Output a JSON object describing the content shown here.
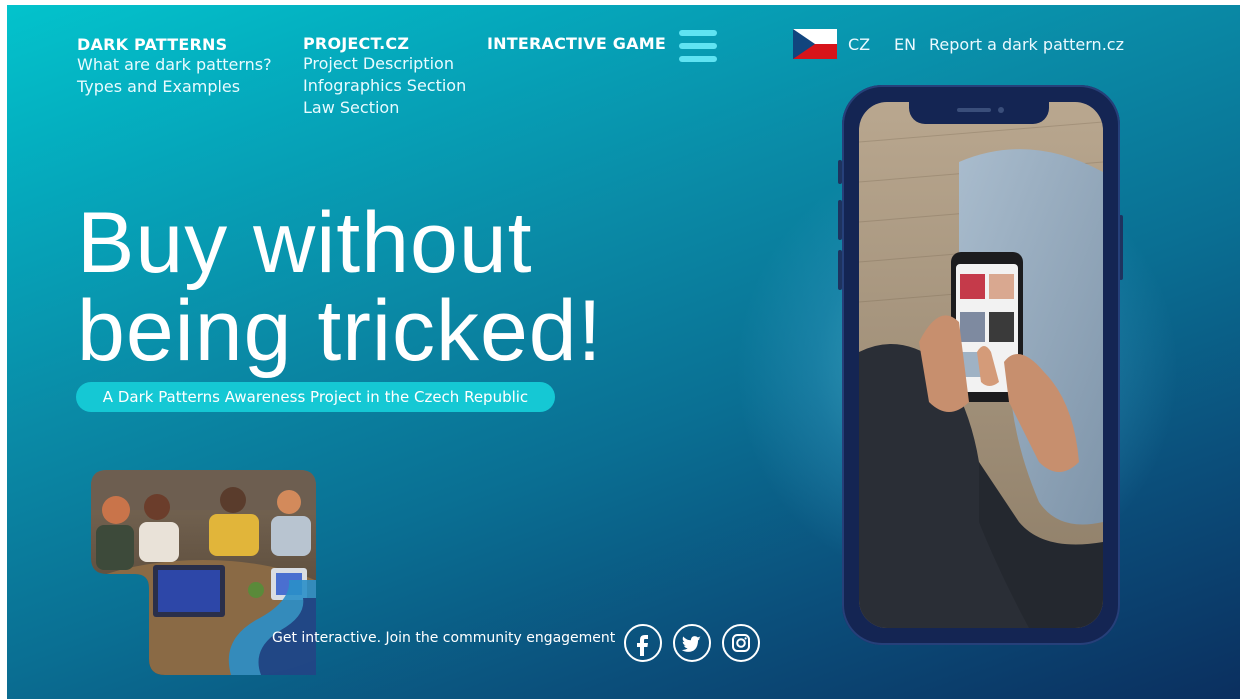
{
  "nav": {
    "dark_patterns": {
      "title": "DARK PATTERNS",
      "items": [
        "What are dark patterns?",
        "Types and Examples"
      ]
    },
    "project": {
      "title": "PROJECT.CZ",
      "items": [
        "Project Description",
        "Infographics Section",
        "Law Section"
      ]
    },
    "interactive_game": "INTERACTIVE GAME"
  },
  "lang": {
    "cz": "CZ",
    "en": "EN"
  },
  "report_link": "Report a dark pattern.cz",
  "hero": {
    "line1": "Buy without",
    "line2": "being tricked!"
  },
  "tagline": "A Dark Patterns Awareness Project in the Czech Republic",
  "community_text": "Get interactive. Join the community engagement",
  "social_icons": [
    "facebook-icon",
    "twitter-icon",
    "instagram-icon"
  ],
  "colors": {
    "accent": "#15c8d4",
    "hamburger": "#5fe3f2",
    "phone_frame": "#142553",
    "background_top": "#03c3cc",
    "background_bottom": "#0b2f5f"
  }
}
